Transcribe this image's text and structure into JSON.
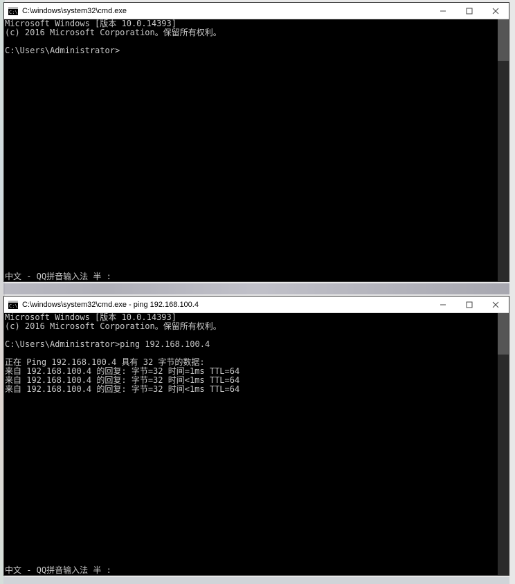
{
  "window1": {
    "title": "C:\\windows\\system32\\cmd.exe",
    "lines": [
      "Microsoft Windows [版本 10.0.14393]",
      "(c) 2016 Microsoft Corporation。保留所有权利。",
      "",
      "C:\\Users\\Administrator>"
    ],
    "ime": "中文 - QQ拼音输入法 半 :"
  },
  "window2": {
    "title": "C:\\windows\\system32\\cmd.exe - ping  192.168.100.4",
    "lines": [
      "Microsoft Windows [版本 10.0.14393]",
      "(c) 2016 Microsoft Corporation。保留所有权利。",
      "",
      "C:\\Users\\Administrator>ping 192.168.100.4",
      "",
      "正在 Ping 192.168.100.4 具有 32 字节的数据:",
      "来自 192.168.100.4 的回复: 字节=32 时间=1ms TTL=64",
      "来自 192.168.100.4 的回复: 字节=32 时间<1ms TTL=64",
      "来自 192.168.100.4 的回复: 字节=32 时间<1ms TTL=64"
    ],
    "ime": "中文 - QQ拼音输入法 半 :"
  }
}
